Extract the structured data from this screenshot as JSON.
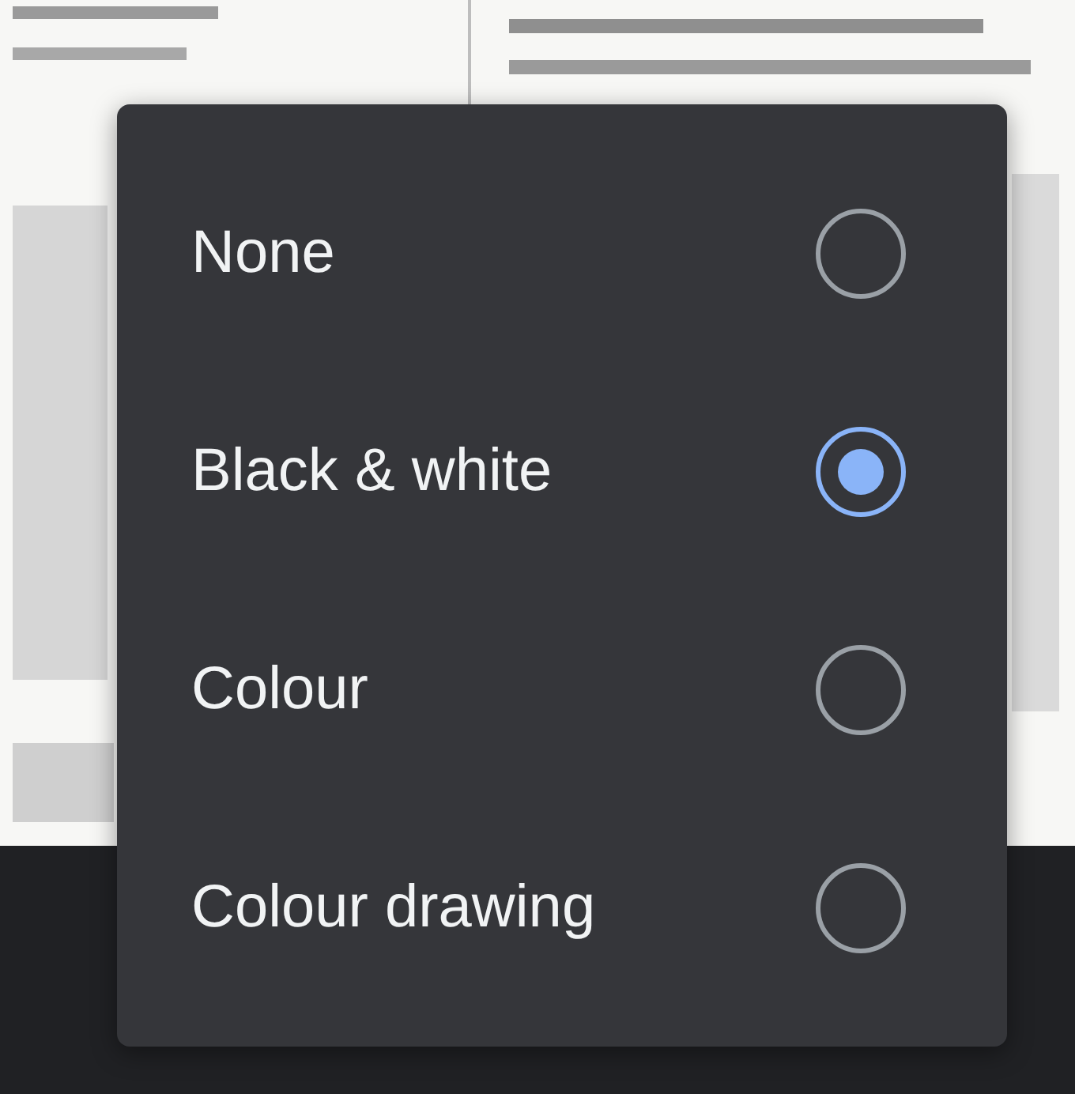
{
  "options": [
    {
      "label": "None",
      "selected": false
    },
    {
      "label": "Black & white",
      "selected": true
    },
    {
      "label": "Colour",
      "selected": false
    },
    {
      "label": "Colour drawing",
      "selected": false
    }
  ]
}
